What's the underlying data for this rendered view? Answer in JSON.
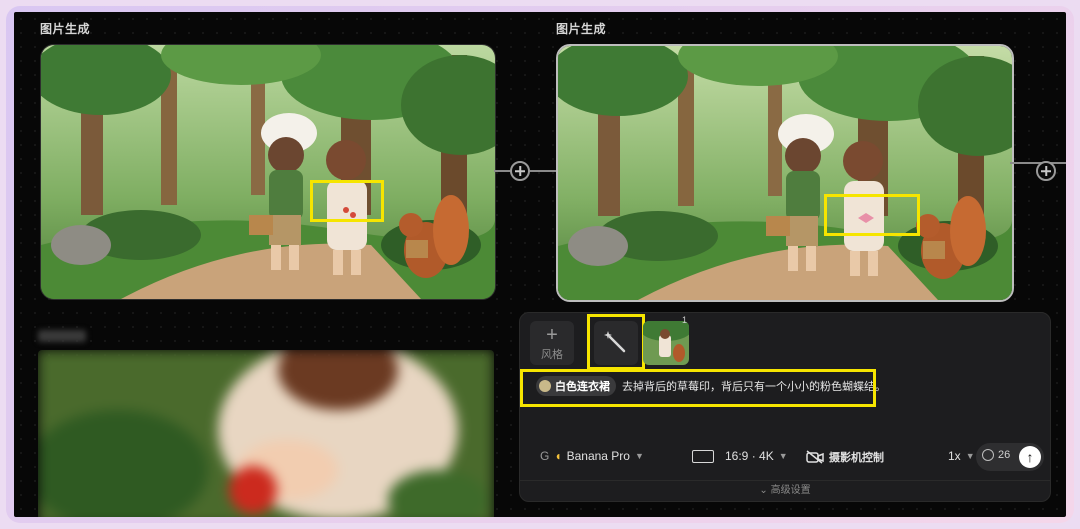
{
  "left_node": {
    "title": "图片生成"
  },
  "right_node": {
    "title": "图片生成"
  },
  "panel": {
    "style_button_label": "风格",
    "thumbnail_count": "1",
    "prompt_chip": "白色连衣裙",
    "prompt_text": "去掉背后的草莓印，背后只有一个小小的粉色蝴蝶结。",
    "model_prefix": "G",
    "model_name": "Banana Pro",
    "aspect": "16:9 · 4K",
    "camera_control": "摄影机控制",
    "multiplier": "1x",
    "credits": "26",
    "send_icon": "↑",
    "advanced_settings": "高级设置"
  },
  "colors": {
    "highlight": "#f6e500",
    "panel_bg": "#1d1d1f"
  }
}
